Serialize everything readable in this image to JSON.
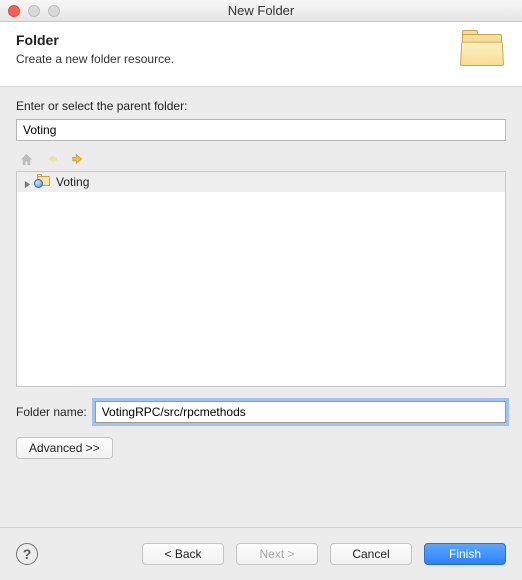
{
  "window": {
    "title": "New Folder"
  },
  "header": {
    "title": "Folder",
    "subtitle": "Create a new folder resource."
  },
  "parent": {
    "label": "Enter or select the parent folder:",
    "value": "Voting"
  },
  "tree": {
    "items": [
      {
        "label": "Voting"
      }
    ]
  },
  "folder_name": {
    "label": "Folder name:",
    "value": "VotingRPC/src/rpcmethods"
  },
  "buttons": {
    "advanced": "Advanced >>",
    "back": "< Back",
    "next": "Next >",
    "cancel": "Cancel",
    "finish": "Finish"
  },
  "icons": {
    "home": "home-icon",
    "nav_back": "arrow-left-icon",
    "nav_forward": "arrow-right-icon",
    "disclosure": "disclosure-triangle-icon",
    "project": "project-folder-icon",
    "big_folder": "folder-icon",
    "help": "?"
  }
}
